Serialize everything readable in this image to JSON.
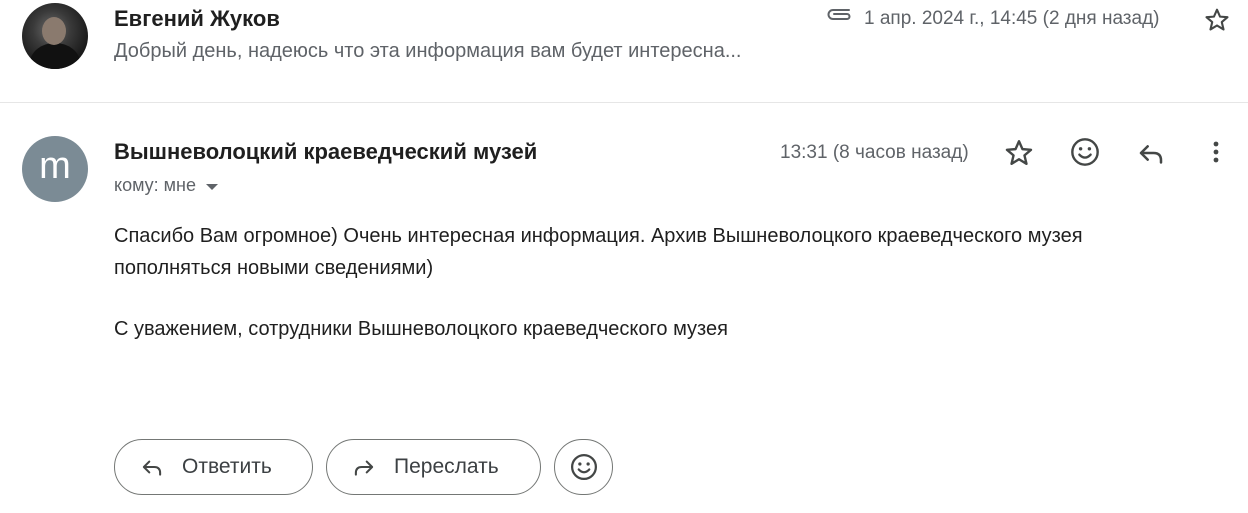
{
  "collapsed_message": {
    "sender": "Евгений Жуков",
    "snippet": "Добрый день, надеюсь что эта информация вам будет интересна...",
    "date": "1 апр. 2024 г., 14:45 (2 дня назад)",
    "attachment_icon": "paperclip-icon",
    "star_icon": "star-outline-icon"
  },
  "expanded_message": {
    "avatar_letter": "m",
    "avatar_color": "#7b8b95",
    "sender": "Вышневолоцкий краеведческий музей",
    "to_line": "кому: мне",
    "time": "13:31 (8 часов назад)",
    "icons": [
      "star-outline-icon",
      "emoji-icon",
      "reply-icon",
      "more-vert-icon"
    ],
    "body": "Спасибо Вам огромное) Очень интересная информация. Архив Вышневолоцкого краеведческого музея пополняться новыми сведениями)",
    "signature": "С уважением, сотрудники Вышневолоцкого краеведческого музея"
  },
  "actions": {
    "reply_label": "Ответить",
    "forward_label": "Переслать"
  }
}
